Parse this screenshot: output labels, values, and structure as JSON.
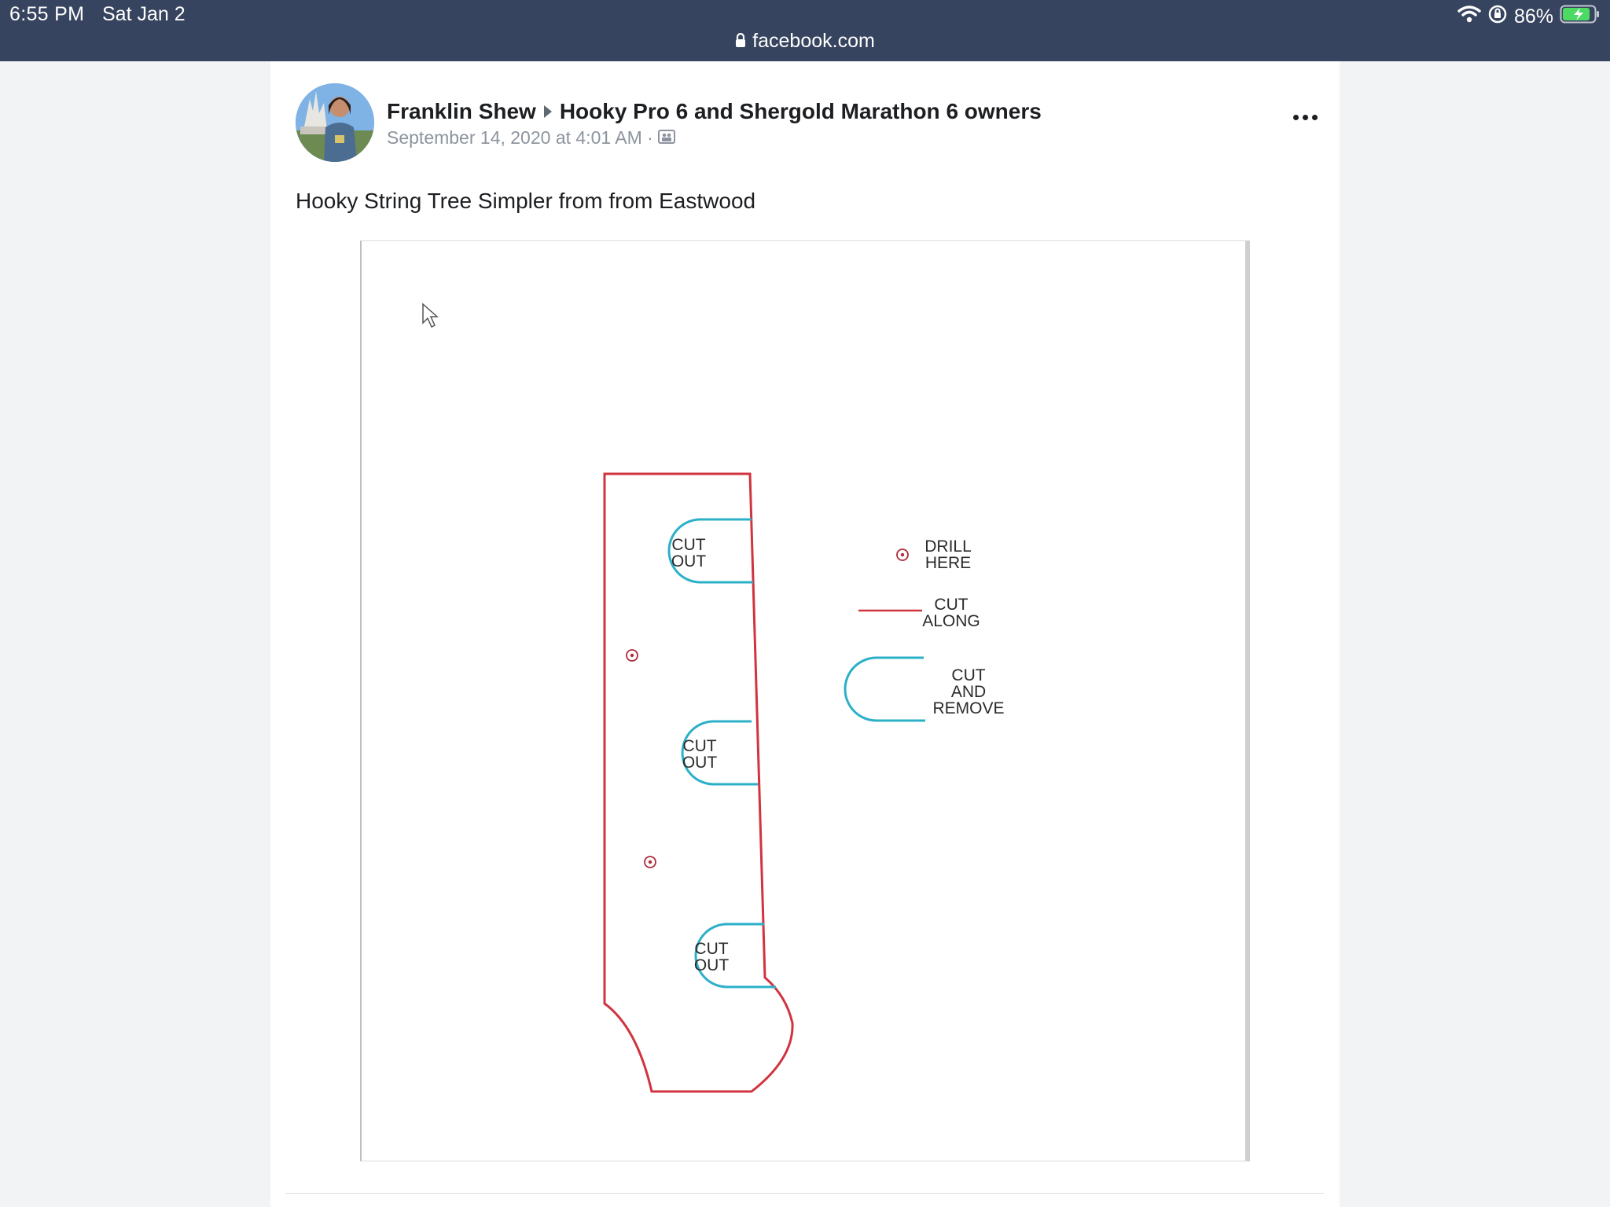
{
  "status_bar": {
    "time": "6:55 PM",
    "date": "Sat Jan 2",
    "battery_percent": "86%",
    "battery_level": 0.86,
    "icons": [
      "wifi-icon",
      "orientation-lock-icon",
      "battery-charging-icon"
    ]
  },
  "browser": {
    "url": "facebook.com",
    "lock_icon": "lock-icon"
  },
  "post": {
    "author": "Franklin Shew",
    "group": "Hooky Pro 6 and Shergold Marathon 6 owners",
    "timestamp": "September 14, 2020 at 4:01 AM ·",
    "audience_icon": "group-audience-icon",
    "more_icon": "more-options-icon",
    "text": "Hooky String Tree Simpler from from Eastwood"
  },
  "diagram": {
    "cutouts": [
      {
        "line1": "CUT",
        "line2": "OUT"
      },
      {
        "line1": "CUT",
        "line2": "OUT"
      },
      {
        "line1": "CUT",
        "line2": "OUT"
      }
    ],
    "legend": {
      "drill": {
        "line1": "DRILL",
        "line2": "HERE"
      },
      "cut_along": {
        "line1": "CUT",
        "line2": "ALONG"
      },
      "cut_remove": {
        "line1": "CUT",
        "line2": "AND",
        "line3": "REMOVE"
      }
    },
    "colors": {
      "cut_line": "#d0343f",
      "remove_line": "#2cb0c8",
      "drill_mark": "#b02a3a"
    }
  },
  "colors": {
    "status_bar_bg": "#37445f",
    "page_bg": "#f2f3f5",
    "card_bg": "#ffffff"
  }
}
